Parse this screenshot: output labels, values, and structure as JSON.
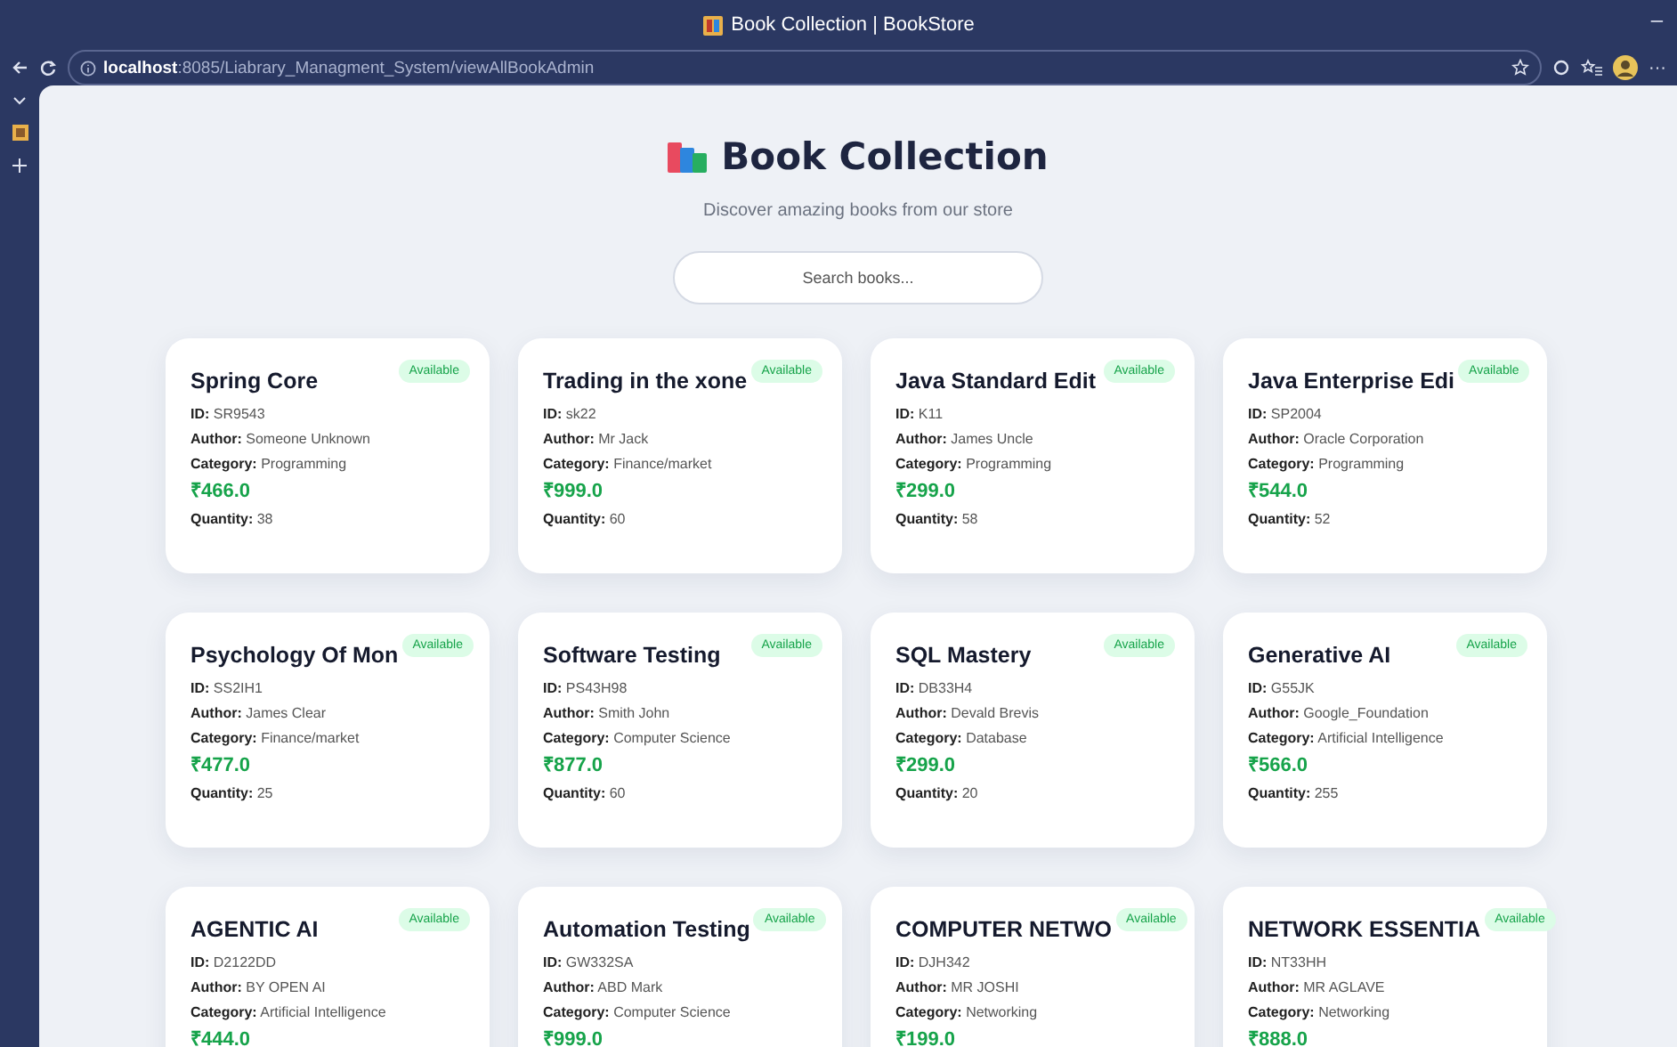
{
  "browser": {
    "tab_title": "Book Collection | BookStore",
    "minimize": "–",
    "url_host": "localhost",
    "url_rest": ":8085/Liabrary_Managment_System/viewAllBookAdmin",
    "more": "···"
  },
  "page": {
    "heading": "Book Collection",
    "subtitle": "Discover amazing books from our store",
    "search": {
      "placeholder": "Search books..."
    },
    "books": [
      {
        "title": "Spring Core",
        "badge": "Available",
        "lines": [
          "**ID:** SR9543",
          "**Author:** Someone Unknown",
          "**Category:** Programming"
        ],
        "price": "₹466.0",
        "quantity": "**Quantity:** 38"
      },
      {
        "title": "Trading in the xone",
        "badge": "Available",
        "lines": [
          "**ID:** sk22",
          "**Author:** Mr Jack",
          "**Category:** Finance/market"
        ],
        "price": "₹999.0",
        "quantity": "**Quantity:** 60"
      },
      {
        "title": "Java Standard Edit",
        "badge": "Available",
        "lines": [
          "**ID:** K11",
          "**Author:** James Uncle",
          "**Category:** Programming"
        ],
        "price": "₹299.0",
        "quantity": "**Quantity:** 58"
      },
      {
        "title": "Java Enterprise Edi",
        "badge": "Available",
        "lines": [
          "**ID:** SP2004",
          "**Author:** Oracle Corporation",
          "**Category:** Programming"
        ],
        "price": "₹544.0",
        "quantity": "**Quantity:** 52"
      },
      {
        "title": "Psychology Of Mon",
        "badge": "Available",
        "lines": [
          "**ID:** SS2IH1",
          "**Author:** James Clear",
          "**Category:** Finance/market"
        ],
        "price": "₹477.0",
        "quantity": "**Quantity:** 25"
      },
      {
        "title": "Software Testing",
        "badge": "Available",
        "lines": [
          "**ID:** PS43H98",
          "**Author:** Smith John",
          "**Category:** Computer Science"
        ],
        "price": "₹877.0",
        "quantity": "**Quantity:** 60"
      },
      {
        "title": "SQL Mastery",
        "badge": "Available",
        "lines": [
          "**ID:** DB33H4",
          "**Author:** Devald Brevis",
          "**Category:** Database"
        ],
        "price": "₹299.0",
        "quantity": "**Quantity:** 20"
      },
      {
        "title": "Generative AI",
        "badge": "Available",
        "lines": [
          "**ID:** G55JK",
          "**Author:** Google_Foundation",
          "**Category:** Artificial Intelligence"
        ],
        "price": "₹566.0",
        "quantity": "**Quantity:** 255"
      },
      {
        "title": "AGENTIC AI",
        "badge": "Available",
        "lines": [
          "**ID:** D2122DD",
          "**Author:** BY OPEN AI",
          "**Category:** Artificial Intelligence"
        ],
        "price": "₹444.0"
      },
      {
        "title": "Automation Testing",
        "badge": "Available",
        "lines": [
          "**ID:** GW332SA",
          "**Author:** ABD Mark",
          "**Category:** Computer Science"
        ],
        "price": "₹999.0"
      },
      {
        "title": "COMPUTER NETWO",
        "badge": "Available",
        "lines": [
          "**ID:** DJH342",
          "**Author:** MR JOSHI",
          "**Category:** Networking"
        ],
        "price": "₹199.0"
      },
      {
        "title": "NETWORK ESSENTIA",
        "badge": "Available",
        "lines": [
          "**ID:** NT33HH",
          "**Author:** MR AGLAVE",
          "**Category:** Networking"
        ],
        "price": "₹888.0"
      }
    ]
  }
}
